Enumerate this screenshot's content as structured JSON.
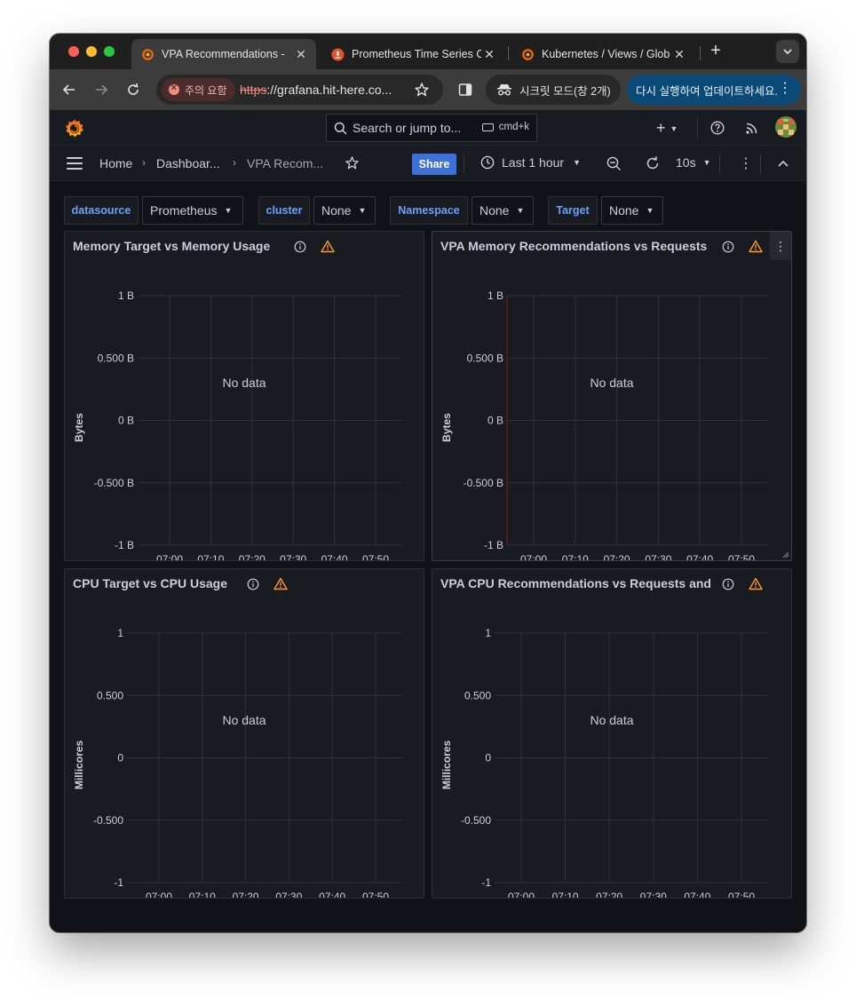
{
  "browser": {
    "tabs": [
      {
        "title": "VPA Recommendations -",
        "active": true,
        "icon": "grafana-icon"
      },
      {
        "title": "Prometheus Time Series C",
        "active": false,
        "icon": "prometheus-icon"
      },
      {
        "title": "Kubernetes / Views / Glob",
        "active": false,
        "icon": "grafana-icon"
      }
    ],
    "security_warning": "주의 요함",
    "url_scheme": "https",
    "url_rest": "://grafana.hit-here.co...",
    "incognito_label": "시크릿 모드(창 2개)",
    "update_label": "다시 실행하여 업데이트하세요."
  },
  "grafana": {
    "search_placeholder": "Search or jump to...",
    "search_shortcut": "cmd+k",
    "breadcrumbs": [
      "Home",
      "Dashboar...",
      "VPA Recom..."
    ],
    "share_label": "Share",
    "time_range": "Last 1 hour",
    "refresh_interval": "10s"
  },
  "variables": [
    {
      "label": "datasource",
      "value": "Prometheus"
    },
    {
      "label": "cluster",
      "value": "None"
    },
    {
      "label": "Namespace",
      "value": "None"
    },
    {
      "label": "Target",
      "value": "None"
    }
  ],
  "no_data_text": "No data",
  "colors": {
    "accent_blue": "#3d71d9",
    "variable_label": "#6e9fff",
    "warning": "#ff9830",
    "background": "#111217",
    "panel": "#181b1f"
  },
  "panels": [
    {
      "title": "Memory Target vs Memory Usage",
      "ylabel": "Bytes",
      "yticks": [
        "1 B",
        "0.500 B",
        "0 B",
        "-0.500 B",
        "-1 B"
      ],
      "xticks": [
        "07:00",
        "07:10",
        "07:20",
        "07:30",
        "07:40",
        "07:50"
      ]
    },
    {
      "title": "VPA Memory Recommendations vs Requests",
      "ylabel": "Bytes",
      "yticks": [
        "1 B",
        "0.500 B",
        "0 B",
        "-0.500 B",
        "-1 B"
      ],
      "xticks": [
        "07:00",
        "07:10",
        "07:20",
        "07:30",
        "07:40",
        "07:50"
      ]
    },
    {
      "title": "CPU Target vs CPU Usage",
      "ylabel": "Millicores",
      "yticks": [
        "1",
        "0.500",
        "0",
        "-0.500",
        "-1"
      ],
      "xticks": [
        "07:00",
        "07:10",
        "07:20",
        "07:30",
        "07:40",
        "07:50"
      ]
    },
    {
      "title": "VPA CPU Recommendations vs Requests and",
      "ylabel": "Millicores",
      "yticks": [
        "1",
        "0.500",
        "0",
        "-0.500",
        "-1"
      ],
      "xticks": [
        "07:00",
        "07:10",
        "07:20",
        "07:30",
        "07:40",
        "07:50"
      ]
    }
  ]
}
